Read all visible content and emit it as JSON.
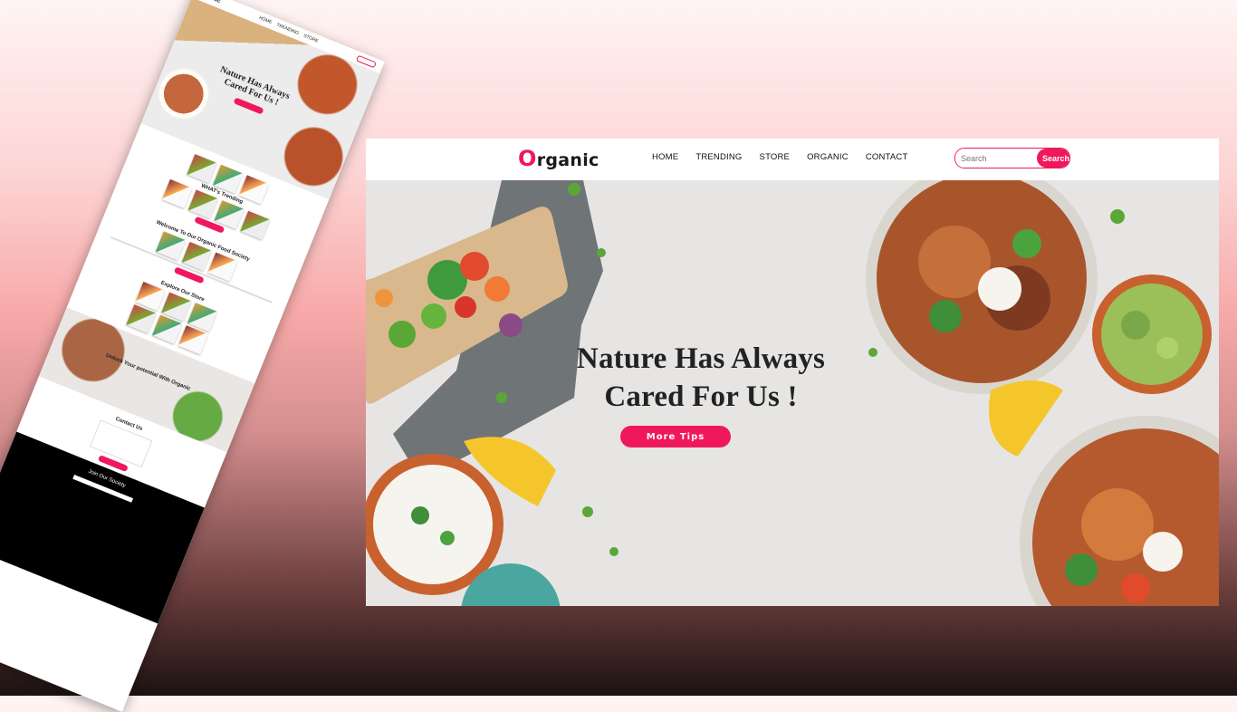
{
  "preview": {
    "logo_first": "O",
    "logo_rest": "rganic",
    "hero_title": "Nature Has Always Cared For Us !",
    "trending_heading": "WHAT's Trending",
    "society_heading": "Welcome To Our Organic Food Society",
    "store_heading": "Explore Our Store",
    "unlock_heading": "Unlock Your potential With Organic",
    "contact_heading": "Contact Us",
    "footer_heading": "Join Our Society"
  },
  "nav": {
    "logo_first": "O",
    "logo_rest": "rganic",
    "links": [
      "HOME",
      "TRENDING",
      "STORE",
      "ORGANIC",
      "CONTACT"
    ],
    "search_placeholder": "Search",
    "search_button": "Search"
  },
  "hero": {
    "title_line1": "Nature Has Always",
    "title_line2": "Cared For Us !",
    "button": "More Tips"
  },
  "colors": {
    "accent": "#f0185c",
    "hero_bg": "#e6e5e3"
  }
}
